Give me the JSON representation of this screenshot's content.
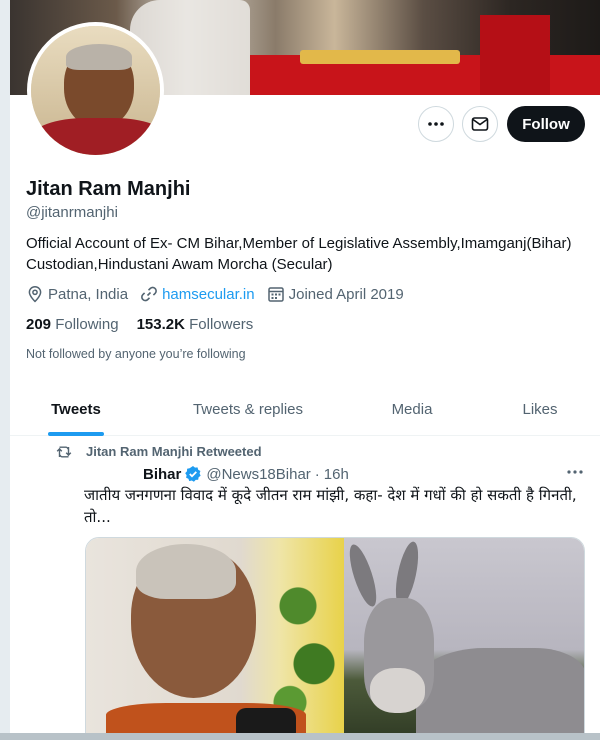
{
  "profile": {
    "name": "Jitan Ram Manjhi",
    "handle": "@jitanrmanjhi",
    "bio_line1": "Official Account of Ex- CM Bihar,Member of Legislative Assembly,Imamganj(Bihar)",
    "bio_line2": "Custodian,Hindustani Awam Morcha (Secular)",
    "location": "Patna, India",
    "website": "hamsecular.in",
    "joined": "Joined April 2019",
    "following_count": "209",
    "following_label": "Following",
    "followers_count": "153.2K",
    "followers_label": "Followers",
    "not_followed_note": "Not followed by anyone you’re following"
  },
  "actions": {
    "follow_label": "Follow",
    "more_icon": "more-icon",
    "message_icon": "envelope-icon"
  },
  "tabs": [
    {
      "label": "Tweets",
      "active": true
    },
    {
      "label": "Tweets & replies",
      "active": false
    },
    {
      "label": "Media",
      "active": false
    },
    {
      "label": "Likes",
      "active": false
    }
  ],
  "tweet": {
    "retweet_note": "Jitan Ram Manjhi Retweeted",
    "author": "Bihar",
    "author_handle": "@News18Bihar",
    "separator": "·",
    "time": "16h",
    "text": "जातीय जनगणना विवाद में कूदे जीतन राम मांझी, कहा- देश में गधों की हो सकती है गिनती, तो..."
  },
  "colors": {
    "accent": "#1d9bf0",
    "text_primary": "#0f1419",
    "text_secondary": "#536471",
    "follow_button_bg": "#0f1419"
  }
}
